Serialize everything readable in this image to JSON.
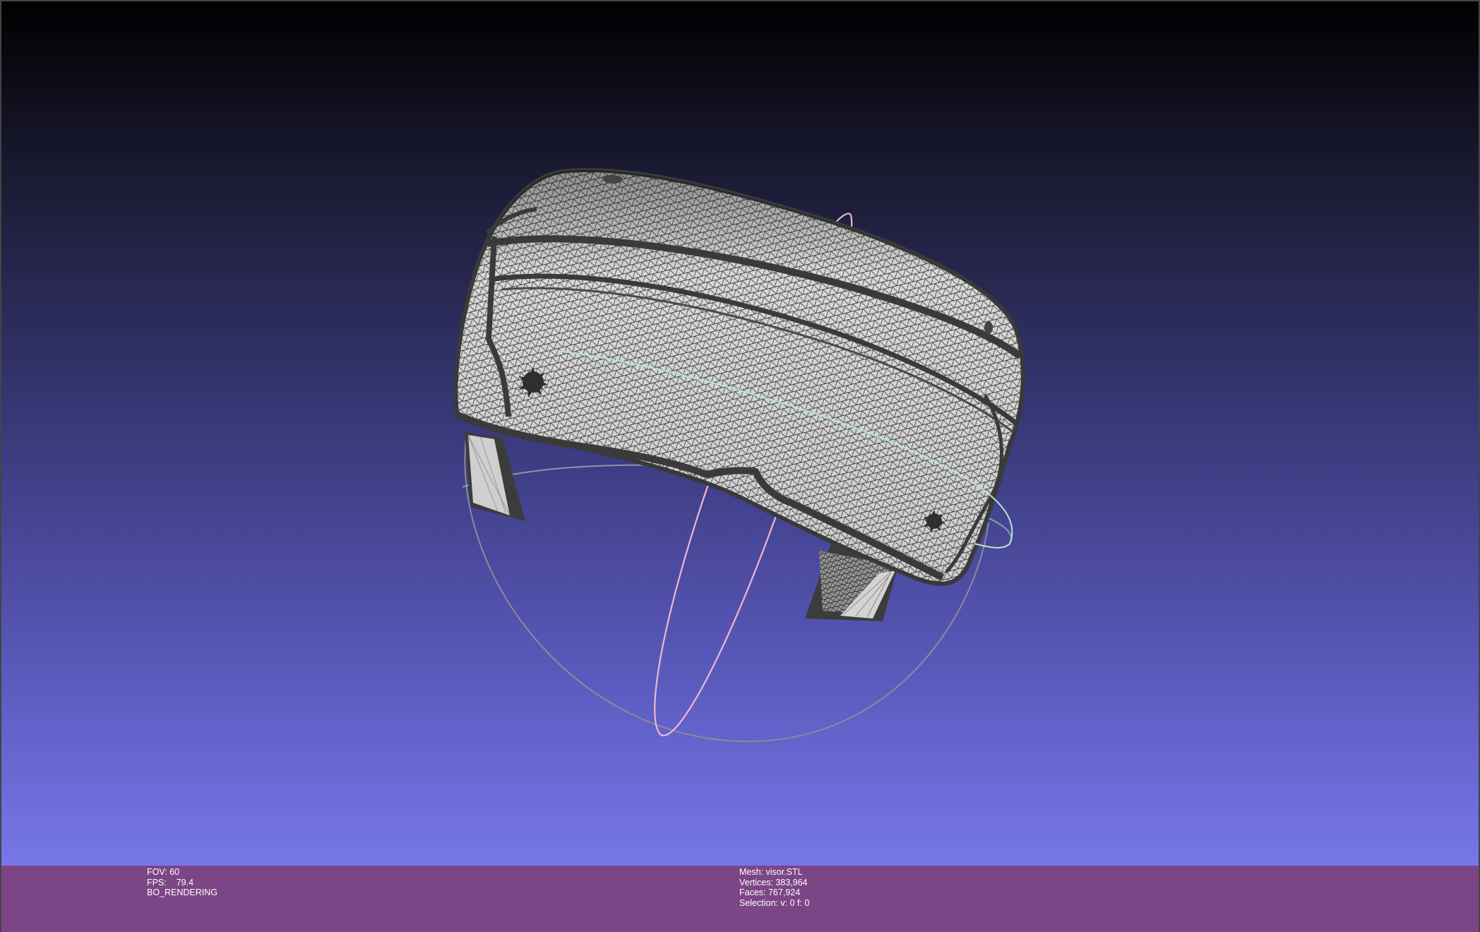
{
  "viewport": {
    "background_top": "#000000",
    "background_bottom": "#7677e8",
    "model": {
      "description_name": "visor-mesh",
      "surface_color": "#d6d6d6",
      "wire_color": "#3c3c3c"
    },
    "trackball": {
      "colors": {
        "x_ring": "#f2b6d2",
        "y_ring": "#b7e8c1",
        "z_ring": "#8a8a9c"
      }
    }
  },
  "info_bar": {
    "background": "#7c4585",
    "render": {
      "fov": "FOV: 60",
      "fps_label": "FPS:",
      "fps_value": "79.4",
      "mode": "BO_RENDERING"
    },
    "mesh": {
      "name": "Mesh: visor.STL",
      "vertices": "Vertices: 383,964",
      "faces": "Faces: 767,924",
      "selection": "Selection: v: 0 f: 0"
    }
  }
}
